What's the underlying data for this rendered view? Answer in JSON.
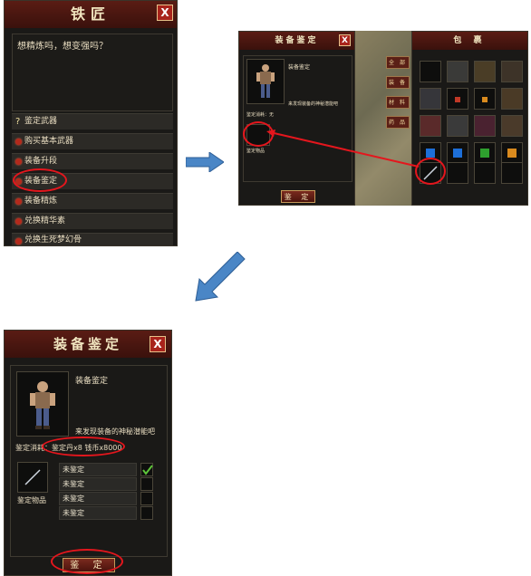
{
  "blacksmith": {
    "title": "铁匠",
    "close": "X",
    "prompt": "想精炼吗，想变强吗？",
    "items": [
      {
        "label": "鉴定武器",
        "icon": "?"
      },
      {
        "label": "购买基本武器"
      },
      {
        "label": "装备升段"
      },
      {
        "label": "装备鉴定"
      },
      {
        "label": "装备精炼"
      },
      {
        "label": "兑换精华素"
      },
      {
        "label": "兑换生死梦幻骨"
      }
    ]
  },
  "identify_small": {
    "title": "装备鉴定",
    "close": "X",
    "name": "装备鉴定",
    "desc": "来发现装备的神秘潜能吧",
    "cost": "鉴定消耗：无",
    "slot_label": "鉴定物品",
    "button": "鉴 定"
  },
  "bag": {
    "title": "包 裹",
    "tabs": [
      "全 部",
      "装 备",
      "材 料",
      "药 品"
    ],
    "colors": {
      "blue": "#1d6fd8",
      "green": "#2ea02e",
      "orange": "#d98a1e",
      "red": "#c03826"
    }
  },
  "identify_large": {
    "title": "装备鉴定",
    "close": "X",
    "name": "装备鉴定",
    "desc": "来发现装备的神秘潜能吧",
    "cost": "鉴定消耗：鉴定丹x8 钱币x8000",
    "slot_label": "鉴定物品",
    "results": [
      {
        "label": "未鉴定",
        "checked": true
      },
      {
        "label": "未鉴定",
        "checked": false
      },
      {
        "label": "未鉴定",
        "checked": false
      },
      {
        "label": "未鉴定",
        "checked": false
      }
    ],
    "button": "鉴 定"
  },
  "annotations": {
    "arrow_color": "#4a86c6",
    "highlight_color": "#e4161d"
  }
}
